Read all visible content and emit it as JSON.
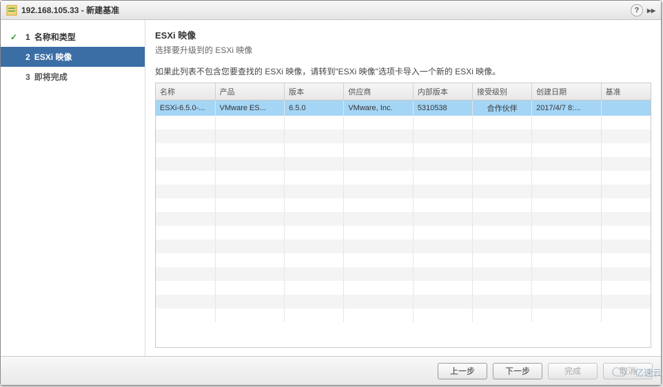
{
  "window": {
    "title": "192.168.105.33 - 新建基准"
  },
  "sidebar": {
    "steps": [
      {
        "num": "1",
        "label": "名称和类型",
        "state": "done"
      },
      {
        "num": "2",
        "label": "ESXi 映像",
        "state": "active"
      },
      {
        "num": "3",
        "label": "即将完成",
        "state": "pending"
      }
    ]
  },
  "main": {
    "heading": "ESXi 映像",
    "subtitle": "选择要升级到的 ESXi 映像",
    "instruction": "如果此列表不包含您要查找的 ESXi 映像，请转到\"ESXi 映像\"选项卡导入一个新的 ESXi 映像。",
    "columns": [
      "名称",
      "产品",
      "版本",
      "供应商",
      "内部版本",
      "接受级别",
      "创建日期",
      "基准"
    ],
    "rows": [
      {
        "c0": "ESXi-6.5.0-...",
        "c1": "VMware ES...",
        "c2": "6.5.0",
        "c3": "VMware, Inc.",
        "c4": "5310538",
        "c5": "合作伙伴",
        "c6": "2017/4/7 8:...",
        "c7": ""
      }
    ]
  },
  "footer": {
    "back": "上一步",
    "next": "下一步",
    "finish": "完成",
    "cancel": "取消"
  },
  "watermark": "亿速云"
}
